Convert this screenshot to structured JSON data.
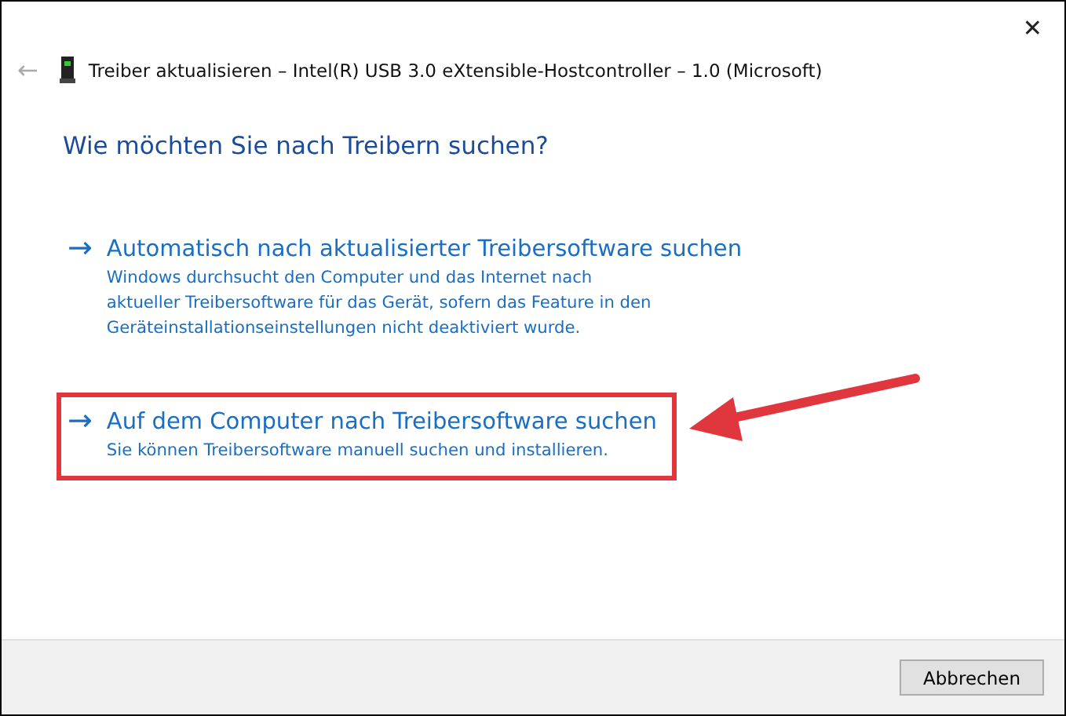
{
  "window": {
    "title": "Treiber aktualisieren – Intel(R) USB 3.0 eXtensible-Hostcontroller – 1.0 (Microsoft)",
    "close": "✕",
    "back": "←"
  },
  "heading": "Wie möchten Sie nach Treibern suchen?",
  "options": [
    {
      "arrow": "→",
      "title": "Automatisch nach aktualisierter Treibersoftware suchen",
      "description": "Windows durchsucht den Computer und das Internet nach aktueller Treibersoftware für das Gerät, sofern das Feature in den Geräteinstallationseinstellungen nicht deaktiviert wurde.",
      "highlighted": false
    },
    {
      "arrow": "→",
      "title": "Auf dem Computer nach Treibersoftware suchen",
      "description": "Sie können Treibersoftware manuell suchen und installieren.",
      "highlighted": true
    }
  ],
  "buttons": [
    "Abbrechen"
  ]
}
